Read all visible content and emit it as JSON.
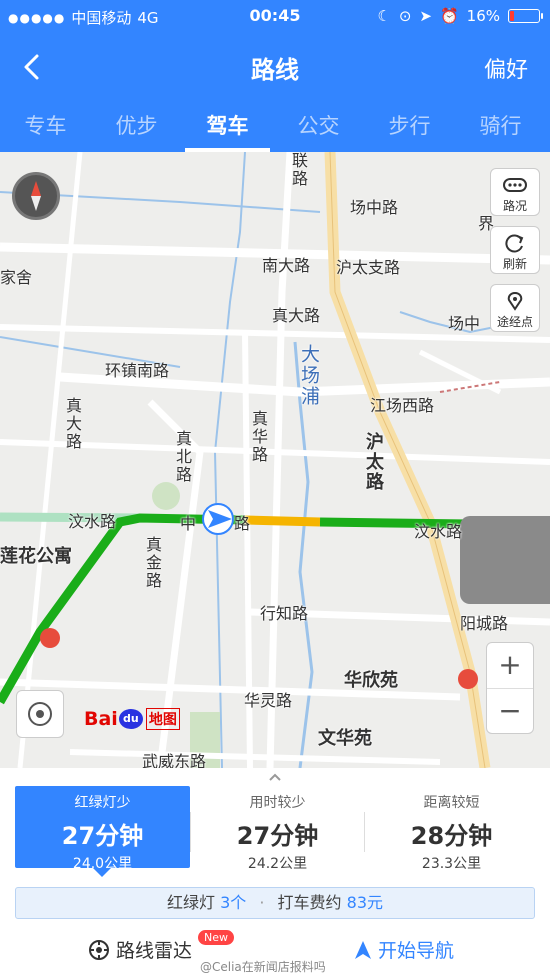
{
  "status": {
    "carrier": "中国移动",
    "network": "4G",
    "time": "00:45",
    "battery": "16%",
    "battery_level": 0.16
  },
  "nav": {
    "title": "路线",
    "preference": "偏好"
  },
  "tabs": [
    {
      "label": "专车",
      "active": false
    },
    {
      "label": "优步",
      "active": false
    },
    {
      "label": "驾车",
      "active": true
    },
    {
      "label": "公交",
      "active": false
    },
    {
      "label": "步行",
      "active": false
    },
    {
      "label": "骑行",
      "active": false
    }
  ],
  "map": {
    "tools": {
      "traffic": "路况",
      "refresh": "刷新",
      "waypoint": "途经点"
    },
    "zoom_in": "+",
    "zoom_out": "−",
    "logo": {
      "bai": "Bai",
      "du": "du",
      "ditu": "地图"
    },
    "labels": {
      "l1": "场中路",
      "l2": "南大路",
      "l3": "沪太支路",
      "l4": "真大路",
      "l5": "场中",
      "l6": "家舍",
      "l7": "环镇南路",
      "l8": "大场浦",
      "l9": "江场西路",
      "l10": "真大路",
      "l11": "真华路",
      "l12": "真北路",
      "l13": "沪太路",
      "l14": "汶水路",
      "l15": "中",
      "l16": "路",
      "l17": "汶水路",
      "l18": "莲花公寓",
      "l19": "真金路",
      "l20": "行知路",
      "l21": "阳城路",
      "l22": "华欣苑",
      "l23": "华灵路",
      "l24": "文华苑",
      "l25": "武威东路",
      "l26": "联路",
      "l27": "界"
    }
  },
  "routes": [
    {
      "tag": "红绿灯少",
      "time": "27分钟",
      "distance": "24.0公里",
      "selected": true
    },
    {
      "tag": "用时较少",
      "time": "27分钟",
      "distance": "24.2公里",
      "selected": false
    },
    {
      "tag": "距离较短",
      "time": "28分钟",
      "distance": "23.3公里",
      "selected": false
    }
  ],
  "info": {
    "lights_label": "红绿灯",
    "lights_count": "3个",
    "taxi_label": "打车费约",
    "taxi_fare": "83元"
  },
  "actions": {
    "radar": "路线雷达",
    "new_badge": "New",
    "start": "开始导航",
    "watermark": "@Celia在新闻店报料吗"
  },
  "colors": {
    "brand": "#3385ff",
    "route_green": "#1aad19",
    "route_yellow": "#f5b400"
  }
}
